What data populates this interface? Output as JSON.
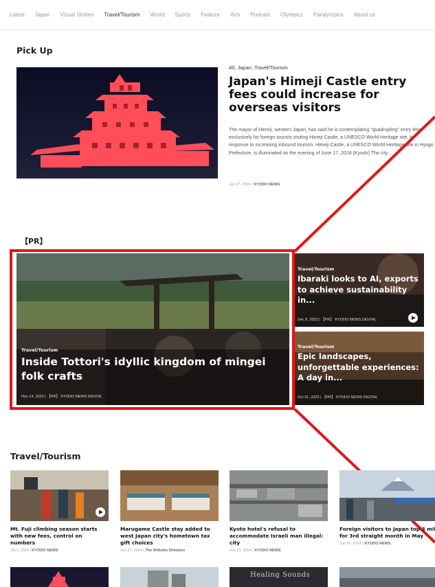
{
  "nav": {
    "items": [
      "Latest",
      "Japan",
      "Visual Stories",
      "Travel/Tourism",
      "World",
      "Sports",
      "Feature",
      "Arts",
      "Podcast",
      "Olympics",
      "Paralympics",
      "About us"
    ],
    "active": "Travel/Tourism"
  },
  "pickup": {
    "heading": "Pick Up",
    "categories": "All, Japan, Travel/Tourism",
    "title": "Japan's Himeji Castle entry fees could increase for overseas visitors",
    "body": "The mayor of Himeji, western Japan, has said he is contemplating \"quadrupling\" entry fees exclusively for foreign tourists visiting Himeji Castle, a UNESCO World Heritage site, in response to increasing inbound tourism. Himeji Castle, a UNESCO World Heritage site in Hyogo Prefecture, is illuminated on the evening of June 17, 2024.(Kyodo) The city...",
    "date": "Jun 17, 2024",
    "source": "KYODO NEWS"
  },
  "pr": {
    "heading": "【PR】",
    "main": {
      "category": "Travel/Tourism",
      "title": "Inside Tottori's idyllic kingdom of mingei folk crafts",
      "date": "Nov 14, 2023",
      "source": "【PR】 KYODO NEWS DIGITAL"
    },
    "side": [
      {
        "category": "Travel/Tourism",
        "title": "Ibaraki looks to AI, exports to achieve sustainability in...",
        "date": "Dec 8, 2023",
        "source": "【PR】 KYODO NEWS DIGITAL"
      },
      {
        "category": "Travel/Tourism",
        "title": "Epic landscapes, unforgettable experiences: A day in...",
        "date": "Oct 31, 2023",
        "source": "【PR】 KYODO NEWS DIGITAL"
      }
    ]
  },
  "travel": {
    "heading": "Travel/Tourism",
    "items": [
      {
        "title": "Mt. Fuji climbing season starts with new fees, control on numbers",
        "date": "Jul 1, 2024",
        "source": "KYODO NEWS"
      },
      {
        "title": "Marugame Castle stay added to west Japan city's hometown tax gift choices",
        "date": "Jun 27, 2024",
        "source": "The Shikoku Shimbun"
      },
      {
        "title": "Kyoto hotel's refusal to accommodate Israeli man illegal: city",
        "date": "Jun 21, 2024",
        "source": "KYODO NEWS"
      },
      {
        "title": "Foreign visitors to Japan top 3 mil. for 3rd straight month in May",
        "date": "Jun 20, 2024",
        "source": "KYODO NEWS"
      }
    ],
    "bottom_caption": "Healing Sounds"
  },
  "colors": {
    "accent_red": "#e31616",
    "hero_red": "#ff4a4a",
    "dark_card": "#1a1a1a"
  }
}
